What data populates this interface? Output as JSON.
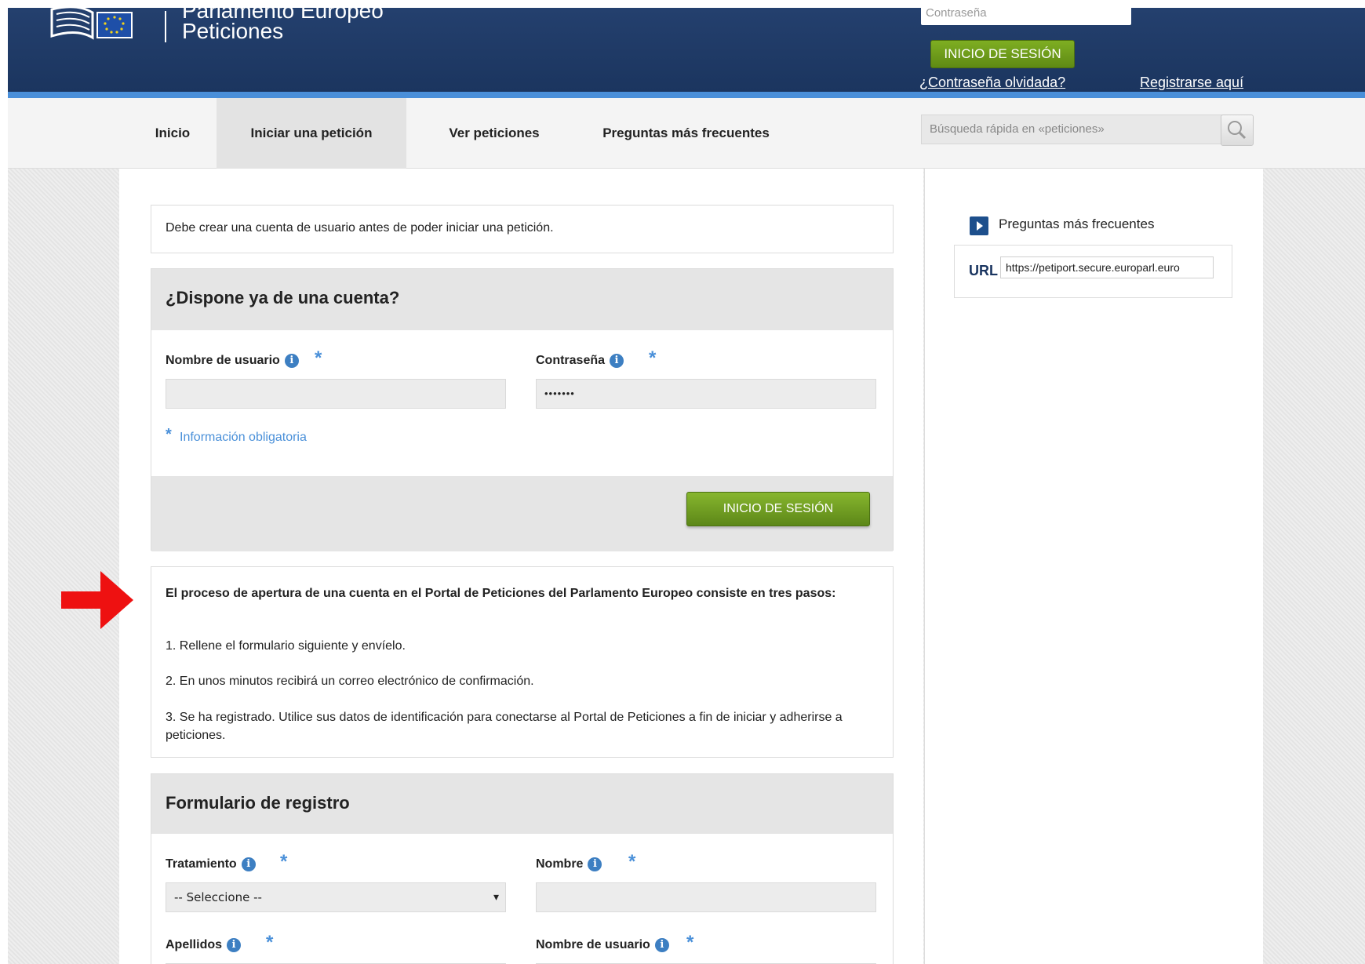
{
  "header": {
    "title_line1": "Parlamento Europeo",
    "title_line2": "Peticiones",
    "password_placeholder": "Contraseña",
    "login_button": "INICIO DE SESIÓN",
    "forgot_password": "¿Contraseña olvidada?",
    "register": "Registrarse aquí"
  },
  "nav": {
    "items": [
      "Inicio",
      "Iniciar una petición",
      "Ver peticiones",
      "Preguntas más frecuentes"
    ],
    "active": "Iniciar una petición",
    "search_placeholder": "Búsqueda rápida en «peticiones»"
  },
  "notice": "Debe crear una cuenta de usuario antes de poder iniciar una petición.",
  "login_box": {
    "title": "¿Dispone ya de una cuenta?",
    "username_label": "Nombre de usuario",
    "password_label": "Contraseña",
    "password_value": "•••••••",
    "required_note": "Información obligatoria",
    "login_button": "INICIO DE SESIÓN"
  },
  "steps_box": {
    "intro": "El proceso de apertura de una cuenta en el Portal de Peticiones del Parlamento Europeo consiste en tres pasos:",
    "step1": "1. Rellene el formulario siguiente y envíelo.",
    "step2": "2. En unos minutos recibirá un correo electrónico de confirmación.",
    "step3": "3. Se ha registrado. Utilice sus datos de identificación para conectarse al Portal de Peticiones a fin de iniciar y adherirse a peticiones."
  },
  "registration": {
    "title": "Formulario de registro",
    "treatment_label": "Tratamiento",
    "treatment_value": "-- Seleccione --",
    "first_name_label": "Nombre",
    "last_name_label": "Apellidos",
    "username_label": "Nombre de usuario"
  },
  "sidebar": {
    "faq_link": "Preguntas más frecuentes",
    "url_label": "URL",
    "url_value": "https://petiport.secure.europarl.euro"
  },
  "colors": {
    "header_bg": "#1f3a66",
    "header_line": "#4a8fd9",
    "button_green": "#6f9a1c",
    "info_blue": "#3d7fc2",
    "arrow_red": "#ee1111"
  }
}
